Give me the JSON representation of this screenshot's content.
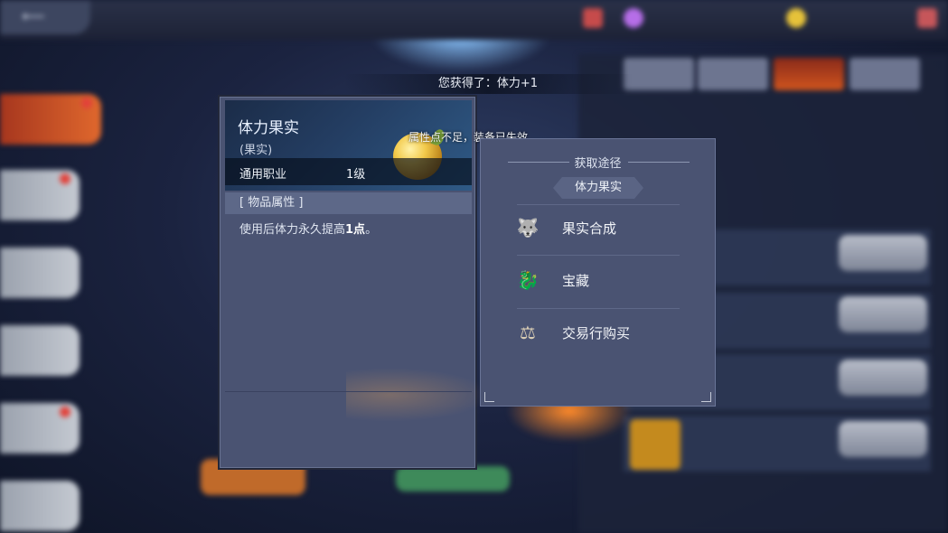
{
  "notification": "您获得了：体力+1",
  "item": {
    "name": "体力果实",
    "type": "(果实)",
    "class": "通用职业",
    "level": "1级",
    "properties_header": "[ 物品属性 ]",
    "description_prefix": "使用后体力永久提高",
    "description_value": "1点",
    "description_suffix": "。"
  },
  "warning": "属性点不足，装备已失效",
  "source": {
    "title": "获取途径",
    "item_tag": "体力果实",
    "rows": [
      {
        "label": "果实合成",
        "icon": "wolf-icon"
      },
      {
        "label": "宝藏",
        "icon": "dragon-icon"
      },
      {
        "label": "交易行购买",
        "icon": "scales-icon"
      }
    ]
  },
  "colors": {
    "panel": "#4a5372",
    "header": "#243e63",
    "accent_orange": "#d0551e"
  }
}
